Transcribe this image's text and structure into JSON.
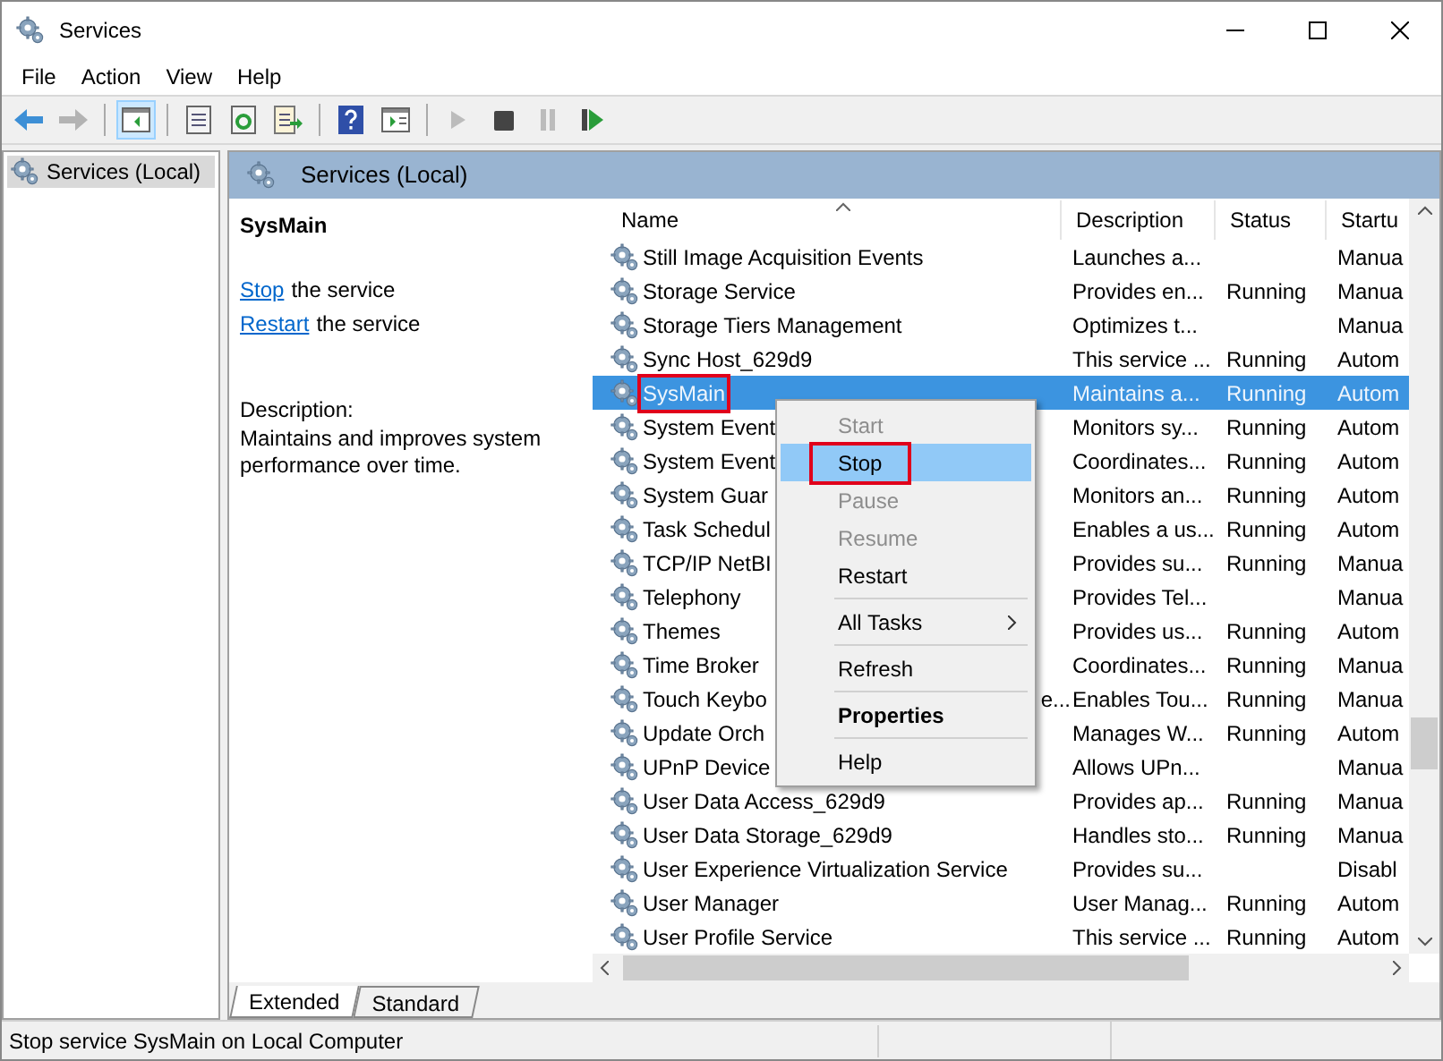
{
  "window": {
    "title": "Services"
  },
  "menu_bar": [
    "File",
    "Action",
    "View",
    "Help"
  ],
  "toolbar": [
    {
      "kind": "back",
      "selected": false,
      "disabled": false
    },
    {
      "kind": "forward",
      "selected": false,
      "disabled": true
    },
    {
      "kind": "tree",
      "selected": true,
      "disabled": false
    },
    {
      "kind": "properties",
      "selected": false,
      "disabled": false
    },
    {
      "kind": "refresh",
      "selected": false,
      "disabled": false
    },
    {
      "kind": "export",
      "selected": false,
      "disabled": false
    },
    {
      "kind": "help",
      "selected": false,
      "disabled": false
    },
    {
      "kind": "panel",
      "selected": false,
      "disabled": false
    },
    {
      "kind": "play",
      "selected": false,
      "disabled": true
    },
    {
      "kind": "stop",
      "selected": false,
      "disabled": false
    },
    {
      "kind": "pause",
      "selected": false,
      "disabled": true
    },
    {
      "kind": "resume",
      "selected": false,
      "disabled": false
    }
  ],
  "tree": [
    {
      "label": "Services (Local)",
      "selected": true
    }
  ],
  "pane_header": "Services (Local)",
  "details": {
    "title": "SysMain",
    "actions": [
      {
        "link": "Stop",
        "text": "the service"
      },
      {
        "link": "Restart",
        "text": "the service"
      }
    ],
    "description_label": "Description:",
    "description": "Maintains and improves system performance over time."
  },
  "table": {
    "columns": [
      "Name",
      "Description",
      "Status",
      "Startu"
    ],
    "rows": [
      {
        "name": "Still Image Acquisition Events",
        "description": "Launches a...",
        "startup": "Manua",
        "selected": false
      },
      {
        "name": "Storage Service",
        "description": "Provides en...",
        "status": "Running",
        "startup": "Manua",
        "selected": false
      },
      {
        "name": "Storage Tiers Management",
        "description": "Optimizes t...",
        "startup": "Manua",
        "selected": false
      },
      {
        "name": "Sync Host_629d9",
        "description": "This service ...",
        "status": "Running",
        "startup": "Autom",
        "selected": false
      },
      {
        "name": "SysMain",
        "description": "Maintains a...",
        "status": "Running",
        "startup": "Autom",
        "selected": true,
        "outlined": true
      },
      {
        "name": "System Event",
        "description": "Monitors sy...",
        "status": "Running",
        "startup": "Autom",
        "selected": false
      },
      {
        "name": "System Event",
        "description": "Coordinates...",
        "status": "Running",
        "startup": "Autom",
        "selected": false
      },
      {
        "name": "System Guar",
        "description": "Monitors an...",
        "status": "Running",
        "startup": "Autom",
        "selected": false
      },
      {
        "name": "Task Schedul",
        "description": "Enables a us...",
        "status": "Running",
        "startup": "Autom",
        "selected": false
      },
      {
        "name": "TCP/IP NetBI",
        "description": "Provides su...",
        "status": "Running",
        "startup": "Manua",
        "selected": false
      },
      {
        "name": "Telephony",
        "description": "Provides Tel...",
        "startup": "Manua",
        "selected": false
      },
      {
        "name": "Themes",
        "description": "Provides us...",
        "status": "Running",
        "startup": "Autom",
        "selected": false
      },
      {
        "name": "Time Broker",
        "description": "Coordinates...",
        "status": "Running",
        "startup": "Manua",
        "selected": false
      },
      {
        "name": "Touch Keybo",
        "name_tail": "e...",
        "description": "Enables Tou...",
        "status": "Running",
        "startup": "Manua",
        "selected": false
      },
      {
        "name": "Update Orch",
        "description": "Manages W...",
        "status": "Running",
        "startup": "Autom",
        "selected": false
      },
      {
        "name": "UPnP Device",
        "description": "Allows UPn...",
        "startup": "Manua",
        "selected": false
      },
      {
        "name": "User Data Access_629d9",
        "description": "Provides ap...",
        "status": "Running",
        "startup": "Manua",
        "selected": false
      },
      {
        "name": "User Data Storage_629d9",
        "description": "Handles sto...",
        "status": "Running",
        "startup": "Manua",
        "selected": false
      },
      {
        "name": "User Experience Virtualization Service",
        "description": "Provides su...",
        "startup": "Disabl",
        "selected": false
      },
      {
        "name": "User Manager",
        "description": "User Manag...",
        "status": "Running",
        "startup": "Autom",
        "selected": false
      },
      {
        "name": "User Profile Service",
        "description": "This service ...",
        "status": "Running",
        "startup": "Autom",
        "selected": false
      }
    ]
  },
  "context_menu": [
    {
      "kind": "item",
      "label": "Start",
      "disabled": true,
      "selected": false
    },
    {
      "kind": "item",
      "label": "Stop",
      "disabled": false,
      "selected": true,
      "outlined": true
    },
    {
      "kind": "item",
      "label": "Pause",
      "disabled": true,
      "selected": false
    },
    {
      "kind": "item",
      "label": "Resume",
      "disabled": true,
      "selected": false
    },
    {
      "kind": "item",
      "label": "Restart",
      "disabled": false,
      "selected": false
    },
    {
      "kind": "separator"
    },
    {
      "kind": "item",
      "label": "All Tasks",
      "disabled": false,
      "selected": false,
      "submenu": true
    },
    {
      "kind": "separator"
    },
    {
      "kind": "item",
      "label": "Refresh",
      "disabled": false,
      "selected": false
    },
    {
      "kind": "separator"
    },
    {
      "kind": "item",
      "label": "Properties",
      "disabled": false,
      "selected": false,
      "default": true
    },
    {
      "kind": "separator"
    },
    {
      "kind": "item",
      "label": "Help",
      "disabled": false,
      "selected": false
    }
  ],
  "view_tabs": [
    {
      "label": "Extended",
      "selected": true
    },
    {
      "label": "Standard",
      "selected": false
    }
  ],
  "status_bar": "Stop service SysMain on Local Computer"
}
